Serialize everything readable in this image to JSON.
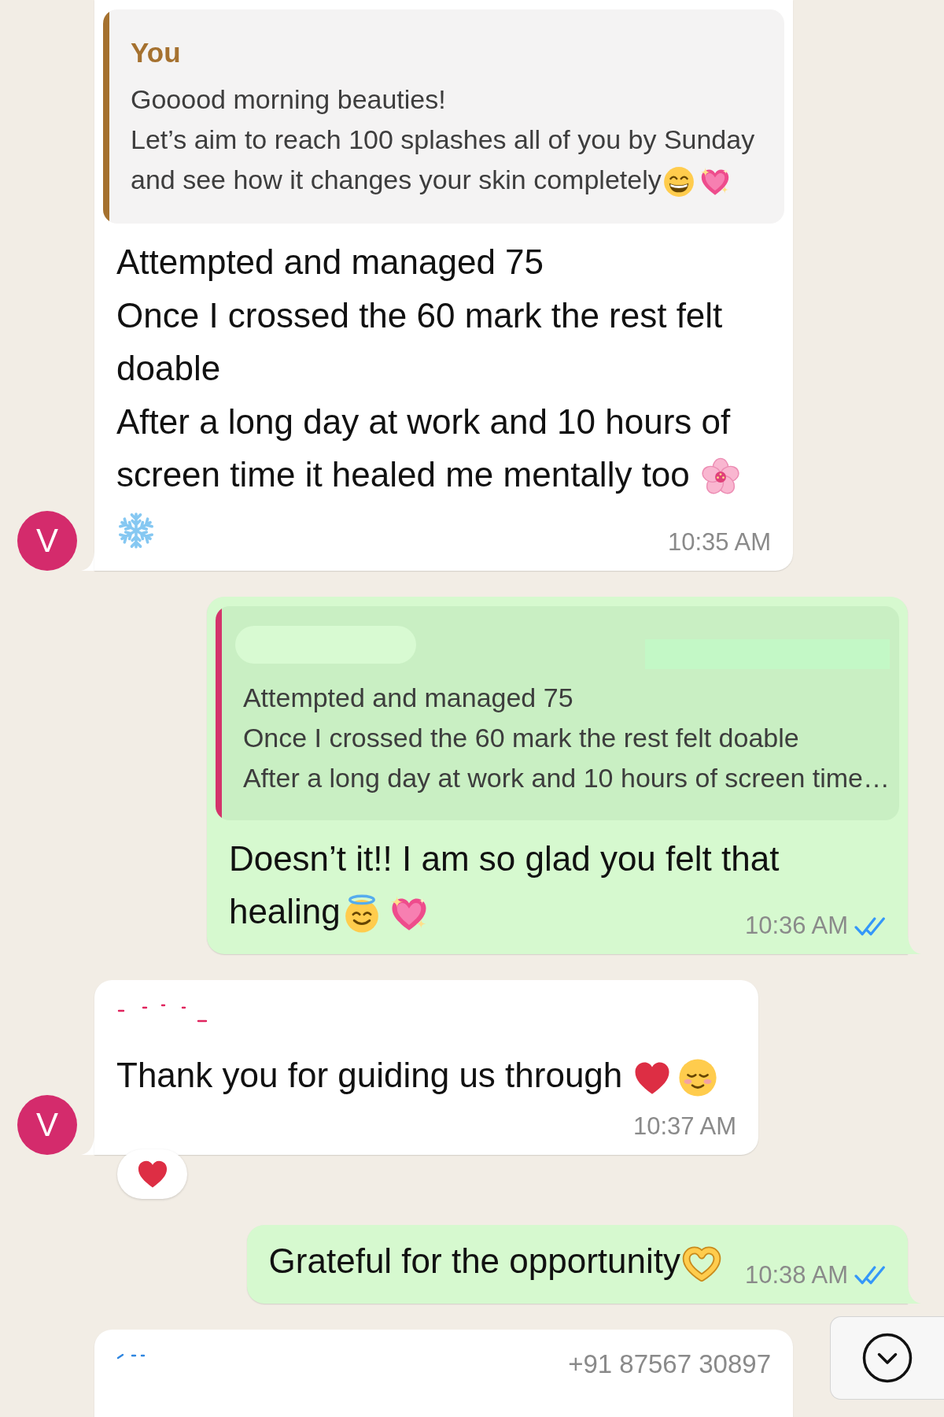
{
  "messages": [
    {
      "kind": "incoming",
      "group_end": true,
      "avatar": "V",
      "quote": {
        "author": "You",
        "color": "#a5712f",
        "lines": [
          "Gooood morning beauties!",
          "Let’s aim to reach 100 splashes all of you by Sunday",
          "and see how it changes your skin completely"
        ]
      },
      "lines": [
        "Attempted and managed 75",
        "Once I crossed the 60 mark the rest felt",
        "doable",
        "After a long day at work and 10 hours of",
        "screen time it healed me mentally too"
      ],
      "time": "10:35 AM",
      "reacted": false
    },
    {
      "kind": "outgoing",
      "group_end": true,
      "quote": {
        "author_redacted": true,
        "color": "#d4336b",
        "lines": [
          "Attempted and managed 75",
          "Once I crossed the 60 mark the rest felt doable",
          "After a long day at work and 10 hours of screen time…"
        ]
      },
      "lines": [
        "Doesn’t it!! I am so glad you felt that",
        "healing"
      ],
      "time": "10:36 AM",
      "read": true,
      "reacted": false
    },
    {
      "kind": "incoming",
      "group_end": true,
      "avatar": "V",
      "sender_redacted": true,
      "color": "#e0245e",
      "lines": [
        "Thank you for guiding us through"
      ],
      "time": "10:37 AM",
      "reacted": true
    },
    {
      "kind": "outgoing",
      "group_end": true,
      "lines": [
        "Grateful for the opportunity"
      ],
      "time": "10:38 AM",
      "read": true,
      "reacted": false
    },
    {
      "kind": "incoming",
      "group_end": false,
      "sender_redacted": true,
      "color": "#2f86e0",
      "sender_phone": "+91 87567 30897",
      "reacted": false
    }
  ],
  "scroll_down_button": true
}
